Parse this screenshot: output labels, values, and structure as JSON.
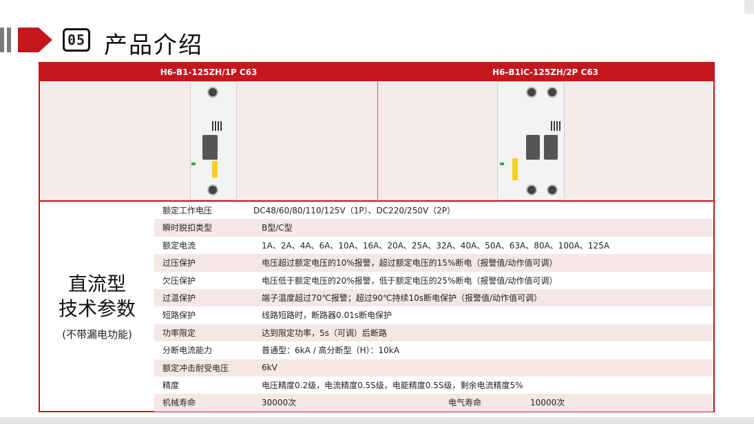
{
  "header": {
    "section_number": "05",
    "section_title": "产品介绍"
  },
  "products": [
    {
      "model": "H6-B1-125ZH/1P C63"
    },
    {
      "model": "H6-B1iC-125ZH/2P C63"
    }
  ],
  "left_title": {
    "line1": "直流型",
    "line2": "技术参数",
    "subtitle": "(不带漏电功能)"
  },
  "specs": [
    {
      "label": "额定工作电压",
      "value": "DC48/60/80/110/125V（1P）、DC220/250V（2P）"
    },
    {
      "label": "瞬时脱扣类型",
      "value": "B型/C型"
    },
    {
      "label": "额定电流",
      "value": "1A、2A、4A、6A、10A、16A、20A、25A、32A、40A、50A、63A、80A、100A、125A"
    },
    {
      "label": "过压保护",
      "value": "电压超过额定电压的10%报警，超过额定电压的15%断电（报警值/动作值可调）"
    },
    {
      "label": "欠压保护",
      "value": "电压低于额定电压的20%报警，低于额定电压的25%断电（报警值/动作值可调）"
    },
    {
      "label": "过温保护",
      "value": "端子温度超过70℃报警；超过90℃持续10s断电保护（报警值/动作值可调）"
    },
    {
      "label": "短路保护",
      "value": "线路短路时，断路器0.01s断电保护"
    },
    {
      "label": "功率限定",
      "value": "达到限定功率，5s（可调）后断路"
    },
    {
      "label": "分断电流能力",
      "value": "普通型：6kA   /   高分断型（H）：10kA"
    },
    {
      "label": "额定冲击耐受电压",
      "value": "6kV"
    },
    {
      "label": "精度",
      "value": "电压精度0.2级，电流精度0.5S级，电能精度0.5S级，剩余电流精度5%"
    },
    {
      "label": "机械寿命",
      "value": "30000次",
      "extra_label": "电气寿命",
      "extra_value": "10000次"
    }
  ],
  "colors": {
    "accent": "#c4161c",
    "row_alt": "#f5e7e7",
    "image_bg": "#f6eaea"
  }
}
